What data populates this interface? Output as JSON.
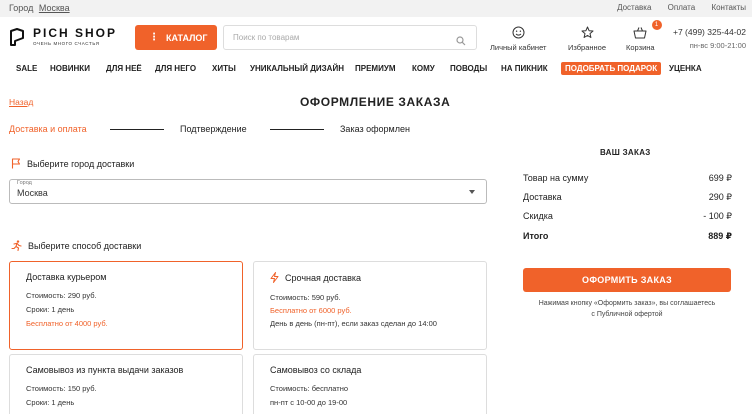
{
  "topbar": {
    "city_label": "Город",
    "city_value": "Москва",
    "links": [
      "Доставка",
      "Оплата",
      "Контакты"
    ]
  },
  "header": {
    "logo_name": "PICH SHOP",
    "logo_slogan": "очень много счастья",
    "catalog_label": "КАТАЛОГ",
    "search_placeholder": "Поиск по товарам",
    "account_label": "Личный кабинет",
    "favorites_label": "Избранное",
    "cart_label": "Корзина",
    "cart_count": "1",
    "phone": "+7 (499) 325-44-02",
    "hours": "пн-вс 9:00-21:00"
  },
  "nav": {
    "items": [
      "SALE",
      "НОВИНКИ",
      "ДЛЯ НЕЁ",
      "ДЛЯ НЕГО",
      "ХИТЫ",
      "УНИКАЛЬНЫЙ ДИЗАЙН",
      "ПРЕМИУМ",
      "КОМУ",
      "ПОВОДЫ",
      "НА ПИКНИК",
      "ПОДОБРАТЬ ПОДАРОК",
      "УЦЕНКА"
    ],
    "active_index": 10
  },
  "page": {
    "back_label": "Назад",
    "title": "ОФОРМЛЕНИЕ ЗАКАЗА",
    "steps": [
      "Доставка и оплата",
      "Подтверждение",
      "Заказ оформлен"
    ],
    "active_step": 0
  },
  "city_section": {
    "heading": "Выберите город доставки",
    "field_label": "Город",
    "field_value": "Москва"
  },
  "delivery_section": {
    "heading": "Выберите способ доставки",
    "options": [
      {
        "name": "Доставка курьером",
        "lines": [
          "Стоимость: 290 руб.",
          "Сроки: 1 день",
          "Бесплатно от 4000 руб."
        ],
        "selected": true
      },
      {
        "name": "Срочная доставка",
        "lines": [
          "Стоимость: 590 руб.",
          "Бесплатно от 6000 руб.",
          "День в день (пн-пт), если заказ сделан до 14:00"
        ],
        "selected": false
      },
      {
        "name": "Самовывоз из пункта выдачи заказов",
        "lines": [
          "Стоимость: 150 руб.",
          "Сроки: 1 день"
        ],
        "selected": false
      },
      {
        "name": "Самовывоз со склада",
        "lines": [
          "Стоимость: бесплатно",
          "пн-пт с 10-00 до 19-00"
        ],
        "selected": false
      }
    ]
  },
  "summary": {
    "title": "ВАШ ЗАКАЗ",
    "rows": [
      {
        "label": "Товар на сумму",
        "value": "699 ₽"
      },
      {
        "label": "Доставка",
        "value": "290 ₽"
      },
      {
        "label": "Скидка",
        "value": "- 100 ₽"
      },
      {
        "label": "Итого",
        "value": "889 ₽"
      }
    ],
    "button_label": "ОФОРМИТЬ ЗАКАЗ",
    "agreement_line1": "Нажимая кнопку «Оформить заказ», вы соглашаетесь",
    "agreement_line2": "с Публичной офертой"
  },
  "colors": {
    "accent": "#f0622a",
    "topbar_bg": "#f2f2f2",
    "text": "#222222"
  }
}
